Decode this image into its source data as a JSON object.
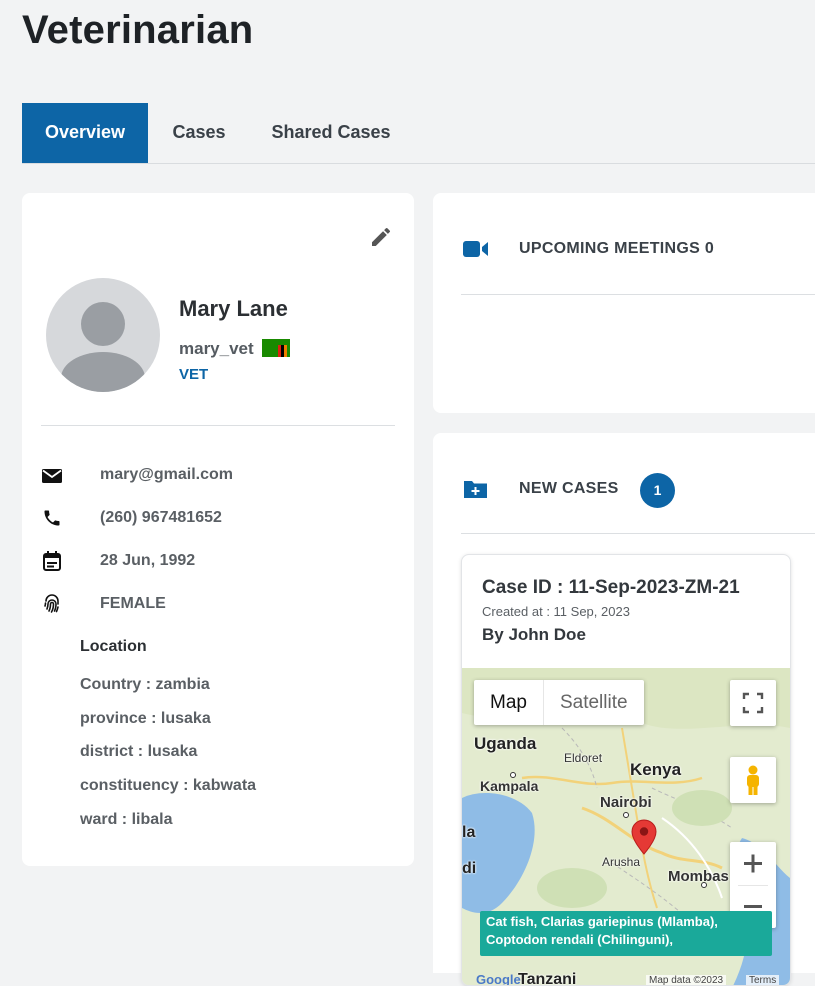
{
  "page": {
    "title": "Veterinarian"
  },
  "tabs": [
    {
      "label": "Overview",
      "active": true
    },
    {
      "label": "Cases",
      "active": false
    },
    {
      "label": "Shared Cases",
      "active": false
    }
  ],
  "profile": {
    "name": "Mary Lane",
    "username": "mary_vet",
    "role": "VET",
    "email": "mary@gmail.com",
    "phone": "(260) 967481652",
    "dob": "28 Jun, 1992",
    "gender": "FEMALE",
    "location_title": "Location",
    "location": [
      "Country : zambia",
      "province : lusaka",
      "district : lusaka",
      "constituency : kabwata",
      "ward : libala"
    ]
  },
  "meetings": {
    "label": "UPCOMING MEETINGS",
    "count": "0"
  },
  "new_cases": {
    "label": "NEW CASES",
    "count": "1"
  },
  "case": {
    "id": "Case ID : 11-Sep-2023-ZM-21",
    "created": "Created at : 11 Sep, 2023",
    "by": "By John Doe"
  },
  "map": {
    "type_map": "Map",
    "type_satellite": "Satellite",
    "labels": {
      "uganda": "Uganda",
      "kampala": "Kampala",
      "eldoret": "Eldoret",
      "kenya": "Kenya",
      "nairobi": "Nairobi",
      "arusha": "Arusha",
      "mombasa": "Mombas",
      "tanzania": "Tanzani",
      "la": "la",
      "di": "di"
    },
    "tooltip_line1": "Cat fish, Clarias gariepinus (Mlamba),",
    "tooltip_line2": "Coptodon rendali (Chilinguni),",
    "attribution": "Map data ©2023",
    "terms": "Terms",
    "google": "Google"
  },
  "colors": {
    "primary": "#0d65a6",
    "tooltip": "#1aa99a",
    "pin": "#e53935"
  }
}
